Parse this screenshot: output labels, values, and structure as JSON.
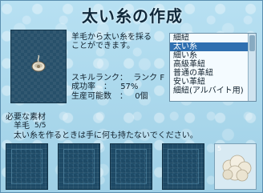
{
  "window": {
    "title": "太い糸の作成"
  },
  "item": {
    "icon": "thread-spool-icon",
    "description": [
      "羊毛から太い糸を採る",
      "ことができます。"
    ]
  },
  "stats": {
    "skill_rank_label": "スキルランク：",
    "skill_rank_value": "ランク F",
    "success_rate_label": "成功率　：",
    "success_rate_value": "57%",
    "producible_label": "生産可能数　：",
    "producible_value": "0個"
  },
  "recipe_list": {
    "items": [
      "細紐",
      "太い糸",
      "細い糸",
      "高級革紐",
      "普通の革紐",
      "安い革紐",
      "細紐(アルバイト用)"
    ],
    "selected_index": 1
  },
  "materials": {
    "label": "必要な素材",
    "name": "羊毛",
    "count": "5/5",
    "note": "太い糸を作るときは手に何も持たないでください。"
  },
  "slots": {
    "filled_count_label": "5",
    "filled_icon": "wool-icon"
  },
  "colors": {
    "background": "#a9d6ea",
    "slot_dark": "#1e4a66",
    "list_selected": "#2f6fb0"
  }
}
